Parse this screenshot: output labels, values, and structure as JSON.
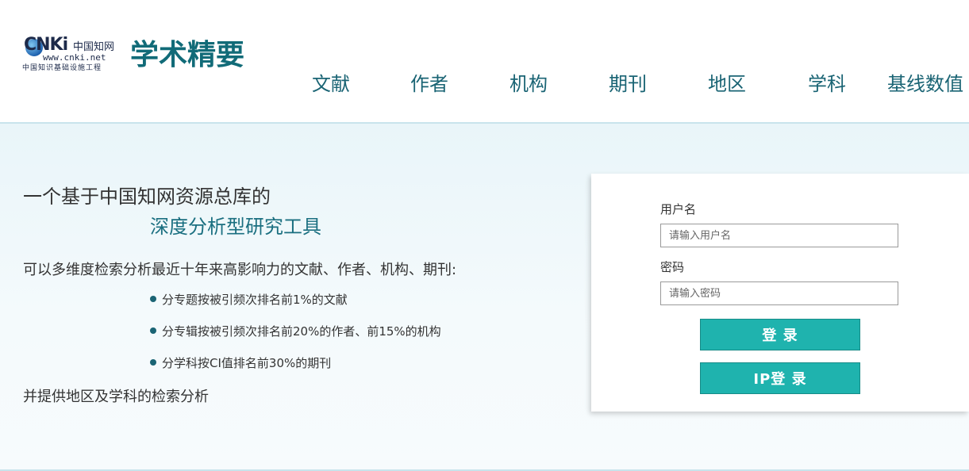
{
  "logo": {
    "brand": "CNKi",
    "brand_cn": "中国知网",
    "url": "www.cnki.net",
    "subtitle": "中国知识基础设施工程",
    "product_name": "学术精要"
  },
  "nav": {
    "items": [
      "文献",
      "作者",
      "机构",
      "期刊",
      "地区",
      "学科",
      "基线数值"
    ]
  },
  "intro": {
    "line1": "一个基于中国知网资源总库的",
    "line2": "深度分析型研究工具",
    "description": "可以多维度检索分析最近十年来高影响力的文献、作者、机构、期刊:",
    "bullets": [
      "分专题按被引频次排名前1%的文献",
      "分专辑按被引频次排名前20%的作者、前15%的机构",
      "分学科按CI值排名前30%的期刊"
    ],
    "footer": "并提供地区及学科的检索分析"
  },
  "login": {
    "username_label": "用户名",
    "username_placeholder": "请输入用户名",
    "password_label": "密码",
    "password_placeholder": "请输入密码",
    "login_button": "登 录",
    "ip_login_button": "IP登 录"
  },
  "colors": {
    "brand_teal": "#116b78",
    "nav_text": "#1a6474",
    "button": "#1fb3ae"
  }
}
